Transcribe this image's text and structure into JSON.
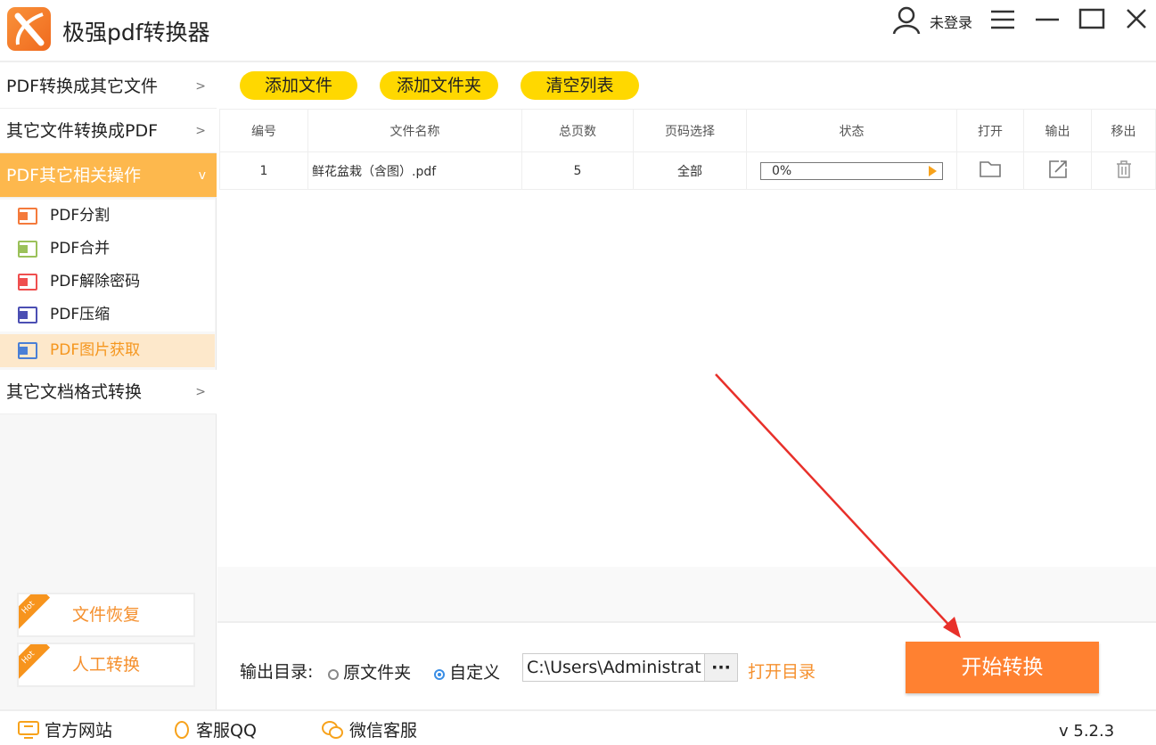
{
  "app": {
    "title": "极强pdf转换器",
    "user": "未登录"
  },
  "sidebar": {
    "categories": [
      {
        "label": "PDF转换成其它文件",
        "chev": ">"
      },
      {
        "label": "其它文件转换成PDF",
        "chev": ">"
      },
      {
        "label": "PDF其它相关操作",
        "chev": "v"
      },
      {
        "label": "其它文档格式转换",
        "chev": ">"
      }
    ],
    "subitems": [
      {
        "label": "PDF分割",
        "color": "#f47a3c"
      },
      {
        "label": "PDF合并",
        "color": "#9bc15a"
      },
      {
        "label": "PDF解除密码",
        "color": "#ef4f4f"
      },
      {
        "label": "PDF压缩",
        "color": "#4b4fb3"
      },
      {
        "label": "PDF图片获取",
        "color": "#4a7fd6"
      }
    ],
    "hot": [
      {
        "label": "文件恢复",
        "tag": "Hot"
      },
      {
        "label": "人工转换",
        "tag": "Hot"
      }
    ]
  },
  "toolbar": {
    "add_file": "添加文件",
    "add_folder": "添加文件夹",
    "clear_list": "清空列表"
  },
  "table": {
    "headers": [
      "编号",
      "文件名称",
      "总页数",
      "页码选择",
      "状态",
      "打开",
      "输出",
      "移出"
    ],
    "rows": [
      {
        "no": "1",
        "name": "鲜花盆栽（含图）.pdf",
        "pages": "5",
        "range": "全部",
        "progress": "0%",
        "progress_value": 0
      }
    ]
  },
  "output": {
    "label": "输出目录:",
    "opt_original": "原文件夹",
    "opt_custom": "自定义",
    "path": "C:\\Users\\Administrat",
    "browse": "···",
    "open_dir": "打开目录",
    "start": "开始转换"
  },
  "footer": {
    "website": "官方网站",
    "qq": "客服QQ",
    "wechat": "微信客服",
    "version": "v 5.2.3"
  },
  "colors": {
    "accent": "#ff8131",
    "yellow": "#ffd800",
    "active": "#fdb84d"
  }
}
